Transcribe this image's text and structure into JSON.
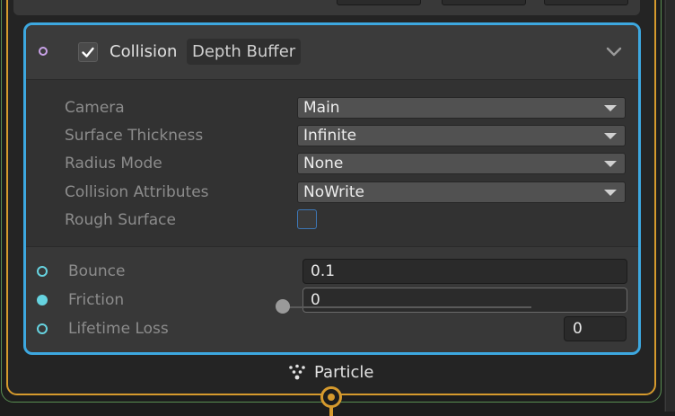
{
  "colors": {
    "block_selection": "#3da8e0",
    "context_border": "#d69a2d",
    "outer_border": "#5a8f52",
    "input_port": "#66d3e0",
    "header_port": "#c9a2e8"
  },
  "block": {
    "enabled": true,
    "title": "Collision",
    "subtitle": "Depth Buffer",
    "collapse_icon": "chevron-down-icon",
    "settings": [
      {
        "label": "Camera",
        "value": "Main"
      },
      {
        "label": "Surface Thickness",
        "value": "Infinite"
      },
      {
        "label": "Radius Mode",
        "value": "None"
      },
      {
        "label": "Collision Attributes",
        "value": "NoWrite"
      }
    ],
    "rough_surface": {
      "label": "Rough Surface",
      "checked": false
    },
    "properties": {
      "bounce": {
        "label": "Bounce",
        "value": "0.1"
      },
      "friction": {
        "label": "Friction",
        "value": "0"
      },
      "lifetime_loss": {
        "label": "Lifetime Loss",
        "value": "0",
        "slider_fraction": 0
      }
    }
  },
  "footer": {
    "icon": "particle-icon",
    "label": "Particle"
  }
}
